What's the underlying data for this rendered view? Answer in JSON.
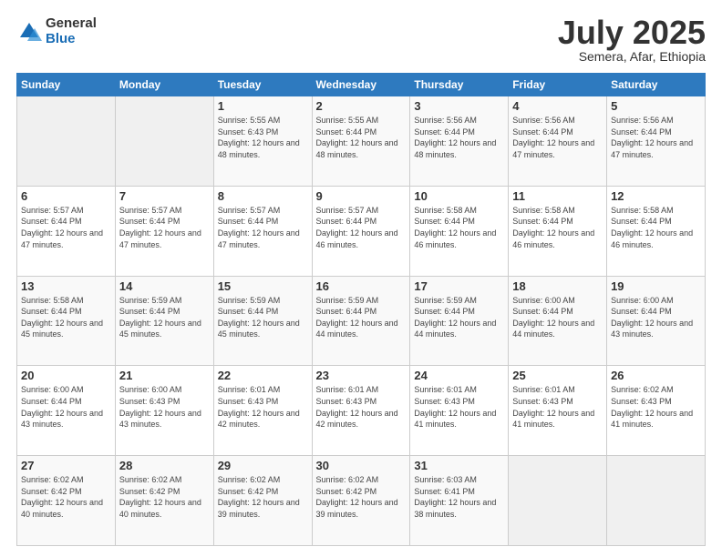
{
  "logo": {
    "general": "General",
    "blue": "Blue"
  },
  "header": {
    "month": "July 2025",
    "location": "Semera, Afar, Ethiopia"
  },
  "days_of_week": [
    "Sunday",
    "Monday",
    "Tuesday",
    "Wednesday",
    "Thursday",
    "Friday",
    "Saturday"
  ],
  "weeks": [
    [
      {
        "day": "",
        "info": ""
      },
      {
        "day": "",
        "info": ""
      },
      {
        "day": "1",
        "info": "Sunrise: 5:55 AM\nSunset: 6:43 PM\nDaylight: 12 hours and 48 minutes."
      },
      {
        "day": "2",
        "info": "Sunrise: 5:55 AM\nSunset: 6:44 PM\nDaylight: 12 hours and 48 minutes."
      },
      {
        "day": "3",
        "info": "Sunrise: 5:56 AM\nSunset: 6:44 PM\nDaylight: 12 hours and 48 minutes."
      },
      {
        "day": "4",
        "info": "Sunrise: 5:56 AM\nSunset: 6:44 PM\nDaylight: 12 hours and 47 minutes."
      },
      {
        "day": "5",
        "info": "Sunrise: 5:56 AM\nSunset: 6:44 PM\nDaylight: 12 hours and 47 minutes."
      }
    ],
    [
      {
        "day": "6",
        "info": "Sunrise: 5:57 AM\nSunset: 6:44 PM\nDaylight: 12 hours and 47 minutes."
      },
      {
        "day": "7",
        "info": "Sunrise: 5:57 AM\nSunset: 6:44 PM\nDaylight: 12 hours and 47 minutes."
      },
      {
        "day": "8",
        "info": "Sunrise: 5:57 AM\nSunset: 6:44 PM\nDaylight: 12 hours and 47 minutes."
      },
      {
        "day": "9",
        "info": "Sunrise: 5:57 AM\nSunset: 6:44 PM\nDaylight: 12 hours and 46 minutes."
      },
      {
        "day": "10",
        "info": "Sunrise: 5:58 AM\nSunset: 6:44 PM\nDaylight: 12 hours and 46 minutes."
      },
      {
        "day": "11",
        "info": "Sunrise: 5:58 AM\nSunset: 6:44 PM\nDaylight: 12 hours and 46 minutes."
      },
      {
        "day": "12",
        "info": "Sunrise: 5:58 AM\nSunset: 6:44 PM\nDaylight: 12 hours and 46 minutes."
      }
    ],
    [
      {
        "day": "13",
        "info": "Sunrise: 5:58 AM\nSunset: 6:44 PM\nDaylight: 12 hours and 45 minutes."
      },
      {
        "day": "14",
        "info": "Sunrise: 5:59 AM\nSunset: 6:44 PM\nDaylight: 12 hours and 45 minutes."
      },
      {
        "day": "15",
        "info": "Sunrise: 5:59 AM\nSunset: 6:44 PM\nDaylight: 12 hours and 45 minutes."
      },
      {
        "day": "16",
        "info": "Sunrise: 5:59 AM\nSunset: 6:44 PM\nDaylight: 12 hours and 44 minutes."
      },
      {
        "day": "17",
        "info": "Sunrise: 5:59 AM\nSunset: 6:44 PM\nDaylight: 12 hours and 44 minutes."
      },
      {
        "day": "18",
        "info": "Sunrise: 6:00 AM\nSunset: 6:44 PM\nDaylight: 12 hours and 44 minutes."
      },
      {
        "day": "19",
        "info": "Sunrise: 6:00 AM\nSunset: 6:44 PM\nDaylight: 12 hours and 43 minutes."
      }
    ],
    [
      {
        "day": "20",
        "info": "Sunrise: 6:00 AM\nSunset: 6:44 PM\nDaylight: 12 hours and 43 minutes."
      },
      {
        "day": "21",
        "info": "Sunrise: 6:00 AM\nSunset: 6:43 PM\nDaylight: 12 hours and 43 minutes."
      },
      {
        "day": "22",
        "info": "Sunrise: 6:01 AM\nSunset: 6:43 PM\nDaylight: 12 hours and 42 minutes."
      },
      {
        "day": "23",
        "info": "Sunrise: 6:01 AM\nSunset: 6:43 PM\nDaylight: 12 hours and 42 minutes."
      },
      {
        "day": "24",
        "info": "Sunrise: 6:01 AM\nSunset: 6:43 PM\nDaylight: 12 hours and 41 minutes."
      },
      {
        "day": "25",
        "info": "Sunrise: 6:01 AM\nSunset: 6:43 PM\nDaylight: 12 hours and 41 minutes."
      },
      {
        "day": "26",
        "info": "Sunrise: 6:02 AM\nSunset: 6:43 PM\nDaylight: 12 hours and 41 minutes."
      }
    ],
    [
      {
        "day": "27",
        "info": "Sunrise: 6:02 AM\nSunset: 6:42 PM\nDaylight: 12 hours and 40 minutes."
      },
      {
        "day": "28",
        "info": "Sunrise: 6:02 AM\nSunset: 6:42 PM\nDaylight: 12 hours and 40 minutes."
      },
      {
        "day": "29",
        "info": "Sunrise: 6:02 AM\nSunset: 6:42 PM\nDaylight: 12 hours and 39 minutes."
      },
      {
        "day": "30",
        "info": "Sunrise: 6:02 AM\nSunset: 6:42 PM\nDaylight: 12 hours and 39 minutes."
      },
      {
        "day": "31",
        "info": "Sunrise: 6:03 AM\nSunset: 6:41 PM\nDaylight: 12 hours and 38 minutes."
      },
      {
        "day": "",
        "info": ""
      },
      {
        "day": "",
        "info": ""
      }
    ]
  ]
}
